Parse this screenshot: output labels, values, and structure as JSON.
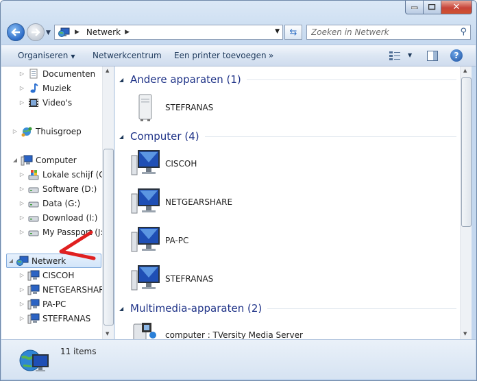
{
  "address": {
    "crumb": "Netwerk"
  },
  "search": {
    "placeholder": "Zoeken in Netwerk"
  },
  "toolbar": {
    "organize": "Organiseren",
    "network_center": "Netwerkcentrum",
    "add_printer": "Een printer toevoegen",
    "more": "»"
  },
  "nav": {
    "libraries": [
      "Documenten",
      "Muziek",
      "Video's"
    ],
    "homegroup": "Thuisgroep",
    "computer": "Computer",
    "drives": [
      "Lokale schijf (C:)",
      "Software (D:)",
      "Data (G:)",
      "Download (I:)",
      "My Passport (J:)"
    ],
    "network": "Netwerk",
    "network_items": [
      "CISCOH",
      "NETGEARSHARE",
      "PA-PC",
      "STEFRANAS"
    ]
  },
  "content": {
    "groups": [
      {
        "label": "Andere apparaten (1)",
        "items": [
          "STEFRANAS"
        ]
      },
      {
        "label": "Computer (4)",
        "items": [
          "CISCOH",
          "NETGEARSHARE",
          "PA-PC",
          "STEFRANAS"
        ]
      },
      {
        "label": "Multimedia-apparaten (2)",
        "items": [
          "computer : TVersity Media Server"
        ]
      }
    ]
  },
  "status": {
    "items": "11 items"
  },
  "colors": {
    "group_heading": "#1e3287",
    "selection": "#d2e5fa",
    "annotation": "#e02020"
  }
}
